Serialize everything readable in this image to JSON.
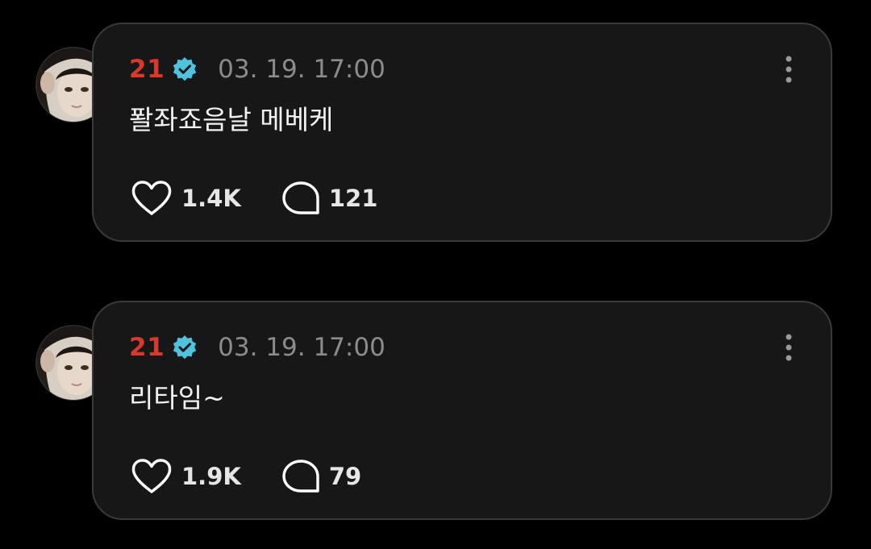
{
  "colors": {
    "background": "#000000",
    "card": "#171717",
    "card_border": "#3a3a3a",
    "username": "#d7392b",
    "verified_badge": "#4fc3dd",
    "timestamp": "#8c8c8c",
    "text": "#f2f2f2"
  },
  "posts": [
    {
      "username": "21",
      "verified_icon": "verified-badge-icon",
      "timestamp": "03. 19. 17:00",
      "content": "퐐좌죠음날 메베케",
      "likes": "1.4K",
      "comments": "121",
      "like_icon": "heart-icon",
      "comment_icon": "comment-bubble-icon",
      "more_icon": "more-vertical-icon"
    },
    {
      "username": "21",
      "verified_icon": "verified-badge-icon",
      "timestamp": "03. 19. 17:00",
      "content": "리타임~",
      "likes": "1.9K",
      "comments": "79",
      "like_icon": "heart-icon",
      "comment_icon": "comment-bubble-icon",
      "more_icon": "more-vertical-icon"
    }
  ]
}
